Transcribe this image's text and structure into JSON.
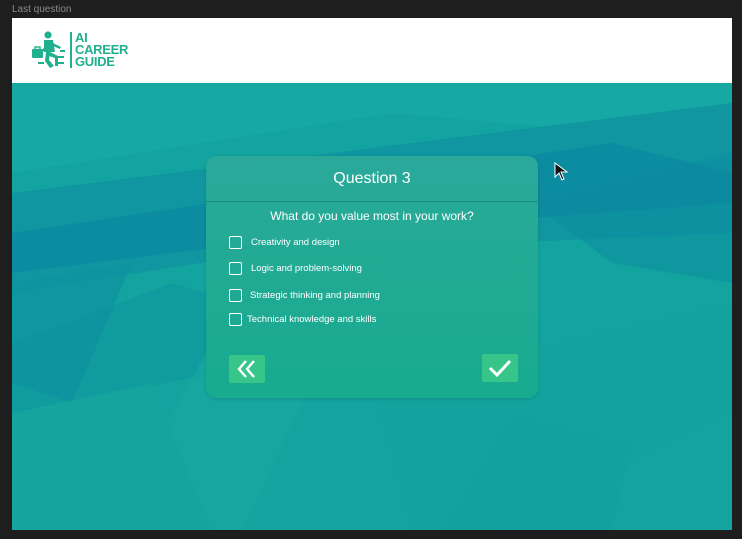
{
  "frame": {
    "label": "Last question"
  },
  "logo": {
    "line1": "AI",
    "line2": "CAREER",
    "line3": "GUIDE"
  },
  "colors": {
    "brand_green": "#21b08e",
    "background_teal": "#12a3a0",
    "card": "#1fab94",
    "button": "#38c58a"
  },
  "card": {
    "title": "Question 3",
    "question": "What do you value most in your work?",
    "options": [
      {
        "label": "Creativity and design",
        "checked": false
      },
      {
        "label": "Logic and problem-solving",
        "checked": false
      },
      {
        "label": "Strategic thinking and planning",
        "checked": false
      },
      {
        "label": "Technical knowledge and skills",
        "checked": false
      }
    ],
    "back_icon": "double-chevron-left-icon",
    "submit_icon": "checkmark-icon"
  }
}
